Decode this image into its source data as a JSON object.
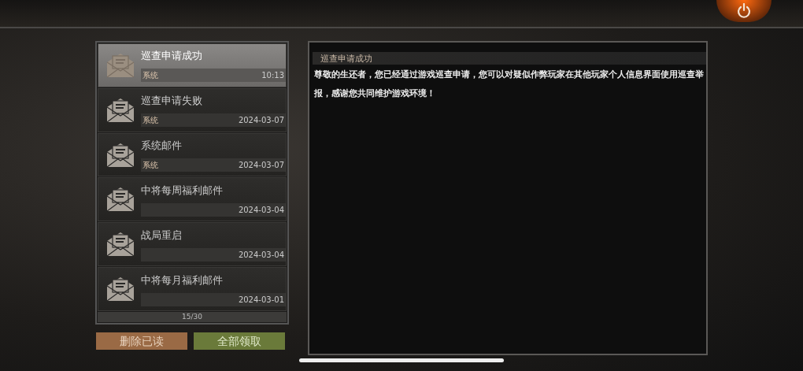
{
  "mails": [
    {
      "title": "巡查申请成功",
      "sender": "系统",
      "time": "10:13",
      "selected": true
    },
    {
      "title": "巡查申请失败",
      "sender": "系统",
      "time": "2024-03-07",
      "selected": false
    },
    {
      "title": "系统邮件",
      "sender": "系统",
      "time": "2024-03-07",
      "selected": false
    },
    {
      "title": "中将每周福利邮件",
      "time": "2024-03-04",
      "selected": false
    },
    {
      "title": "战局重启",
      "time": "2024-03-04",
      "selected": false
    },
    {
      "title": "中将每月福利邮件",
      "time": "2024-03-01",
      "selected": false
    }
  ],
  "counter": "15/30",
  "buttons": [
    {
      "label": "删除已读",
      "kind": "delete"
    },
    {
      "label": "全部领取",
      "kind": "claim"
    }
  ],
  "detail": {
    "title": "巡查申请成功",
    "body": "尊敬的生还者，您已经通过游戏巡查申请，您可以对疑似作弊玩家在其他玩家个人信息界面使用巡查举报，感谢您共同维护游戏环境！"
  }
}
